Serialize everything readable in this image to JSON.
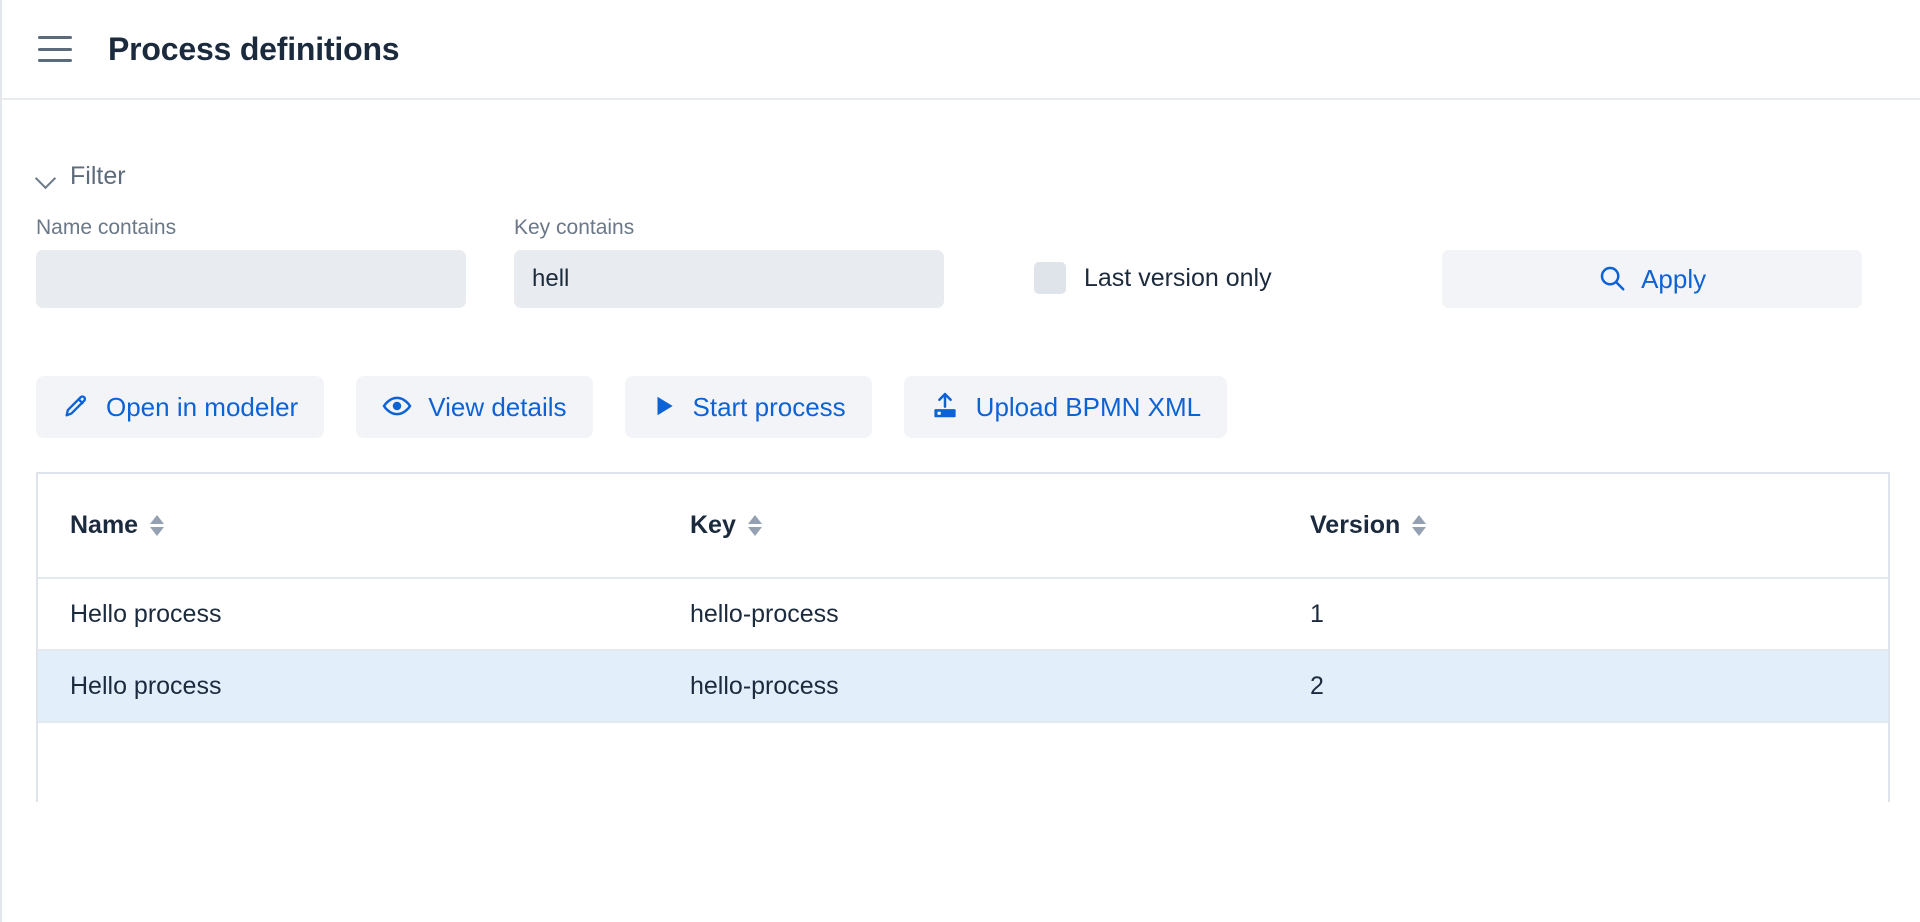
{
  "header": {
    "menu_icon": "hamburger-icon",
    "title": "Process definitions"
  },
  "filter": {
    "toggle_label": "Filter",
    "toggle_icon": "chevron-down-icon",
    "name_field": {
      "label": "Name contains",
      "value": "",
      "placeholder": ""
    },
    "key_field": {
      "label": "Key contains",
      "value": "hell",
      "placeholder": ""
    },
    "last_version_only": {
      "label": "Last version only",
      "checked": false
    },
    "apply_button": {
      "label": "Apply",
      "icon": "search-icon"
    }
  },
  "actions": [
    {
      "label": "Open in modeler",
      "icon": "pencil-icon"
    },
    {
      "label": "View details",
      "icon": "eye-icon"
    },
    {
      "label": "Start process",
      "icon": "play-icon"
    },
    {
      "label": "Upload BPMN XML",
      "icon": "upload-icon"
    }
  ],
  "table": {
    "columns": [
      {
        "label": "Name",
        "sortable": true
      },
      {
        "label": "Key",
        "sortable": true
      },
      {
        "label": "Version",
        "sortable": true
      }
    ],
    "rows": [
      {
        "name": "Hello process",
        "key": "hello-process",
        "version": "1",
        "selected": false
      },
      {
        "name": "Hello process",
        "key": "hello-process",
        "version": "2",
        "selected": true
      }
    ]
  },
  "colors": {
    "accent": "#0d63d6",
    "title": "#1b2a3d",
    "muted": "#6b7888",
    "input_bg": "#e8ecf0",
    "button_bg": "#f3f4f7",
    "row_selected_bg": "#e3eefb",
    "border": "#dfe4ec"
  }
}
